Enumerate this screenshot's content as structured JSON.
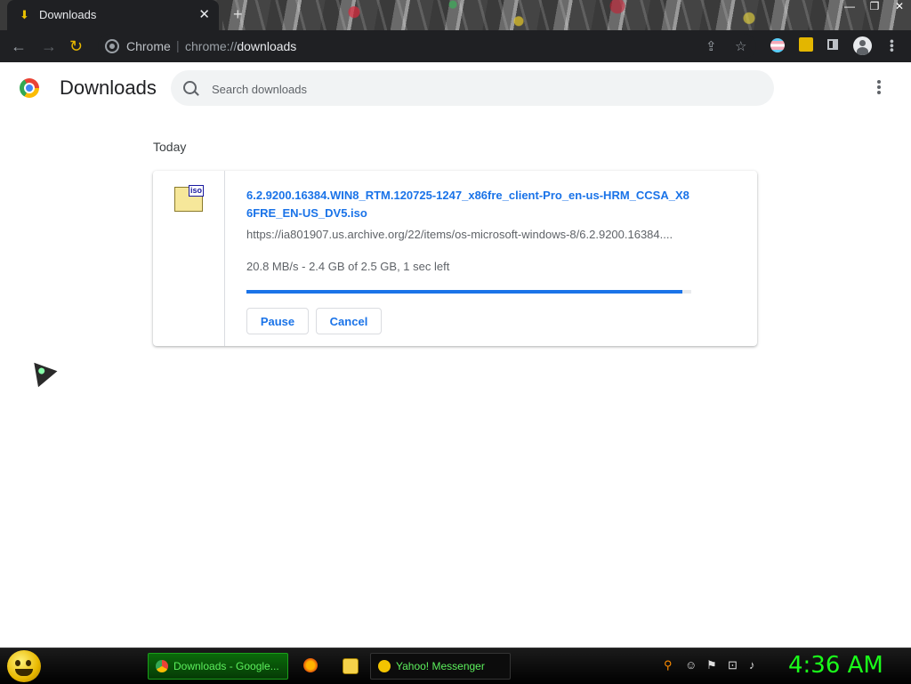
{
  "tab": {
    "title": "Downloads",
    "close": "✕",
    "new": "+"
  },
  "window": {
    "minimize": "—",
    "restore": "❐",
    "close": "✕"
  },
  "omnibox": {
    "site": "Chrome",
    "url_prefix": "chrome://",
    "url_host": "downloads"
  },
  "page": {
    "title": "Downloads",
    "search_placeholder": "Search downloads"
  },
  "downloads": {
    "date_header": "Today",
    "item": {
      "filename": "6.2.9200.16384.WIN8_RTM.120725-1247_x86fre_client-Pro_en-us-HRM_CCSA_X86FRE_EN-US_DV5.iso",
      "url": "https://ia801907.us.archive.org/22/items/os-microsoft-windows-8/6.2.9200.16384....",
      "status": "20.8 MB/s - 2.4 GB of 2.5 GB, 1 sec left",
      "progress": 0.98,
      "icon_label": "iso",
      "pause_label": "Pause",
      "cancel_label": "Cancel"
    }
  },
  "taskbar": {
    "chrome_task": "Downloads - Google...",
    "yahoo_task": "Yahoo! Messenger",
    "clock": "4:36 AM"
  },
  "colors": {
    "accent": "#1a73e8",
    "clock": "#1aff1a"
  }
}
